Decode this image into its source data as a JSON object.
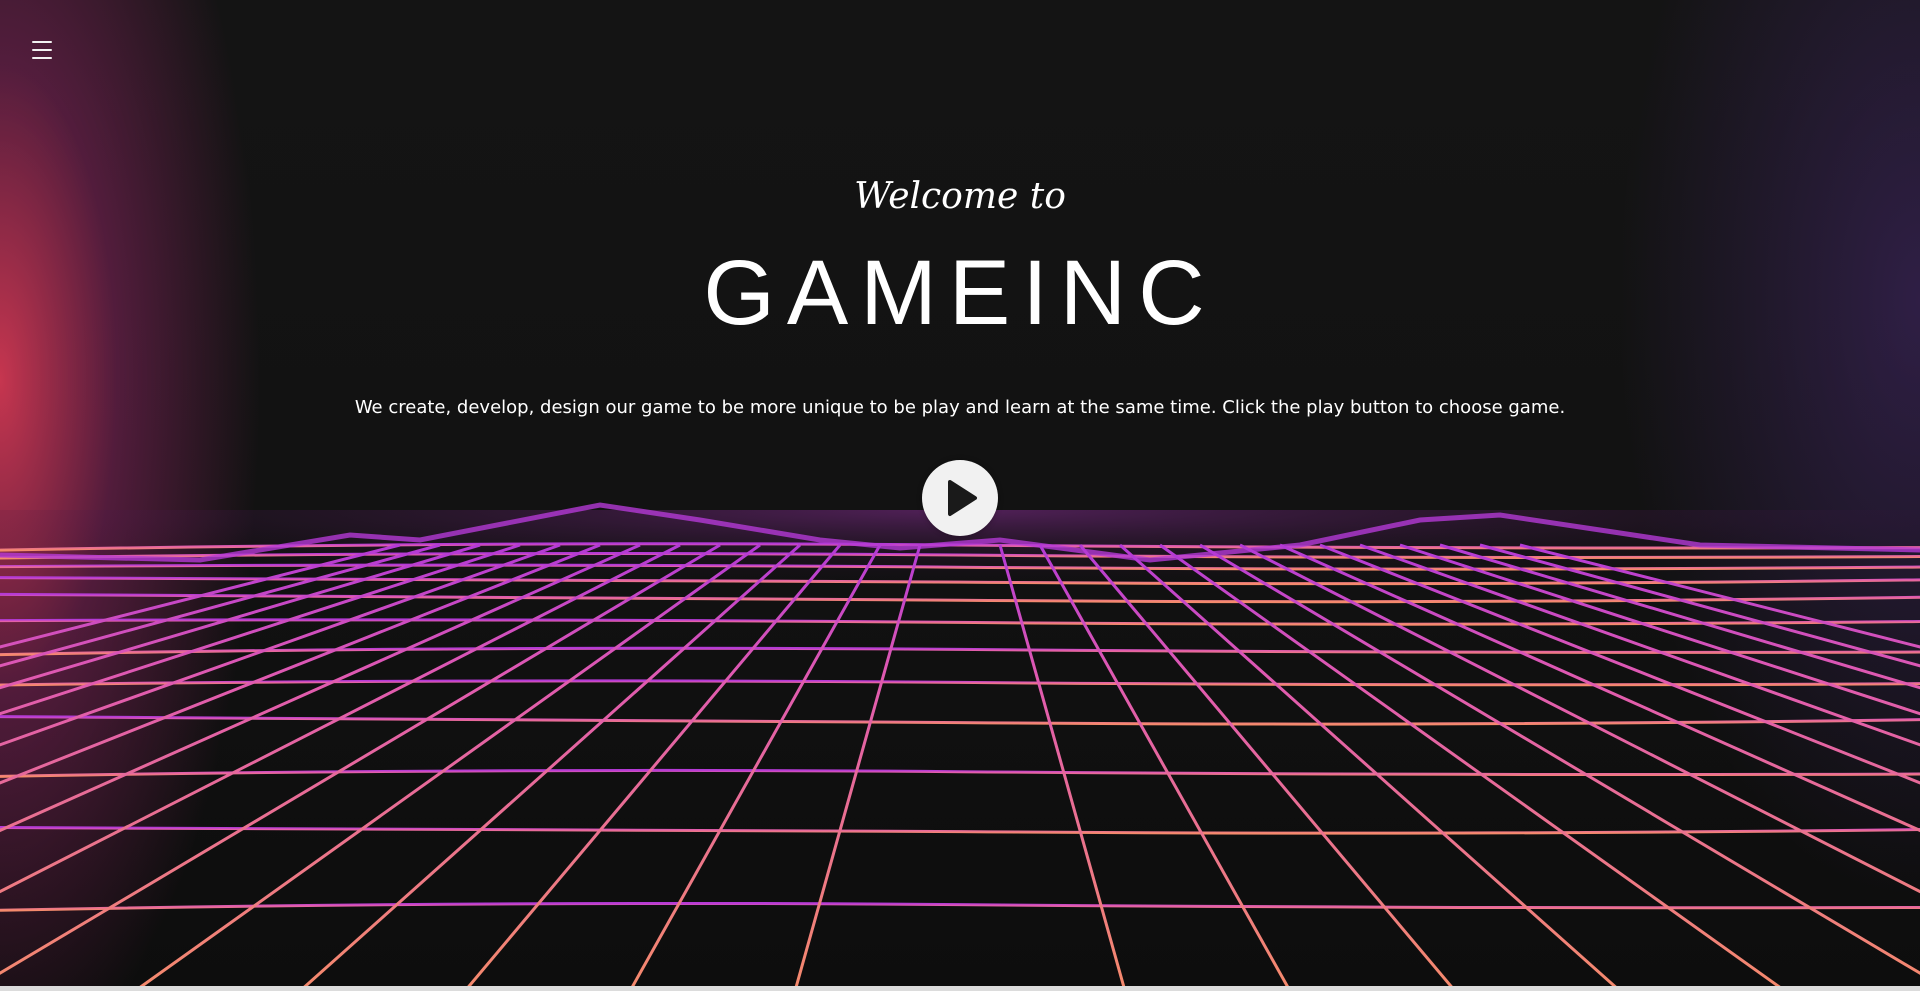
{
  "hero": {
    "welcome": "Welcome to",
    "title": "GAMEINC",
    "tagline": "We create, develop, design our game to be more unique to be play and learn at the same time. Click the play button to choose game."
  },
  "icons": {
    "menu": "hamburger-menu-icon",
    "play": "play-icon"
  },
  "colors": {
    "grid_near": "#f07a6a",
    "grid_far": "#c23fd9",
    "text": "#ffffff",
    "play_button_bg": "#f1f1f1",
    "play_icon": "#1a1a1a"
  }
}
